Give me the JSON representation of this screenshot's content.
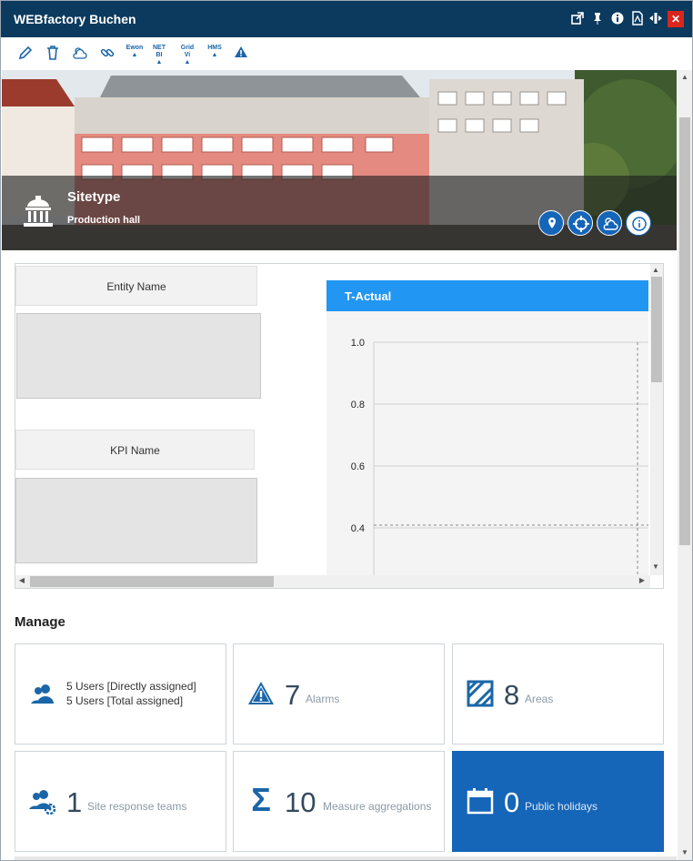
{
  "window": {
    "title": "WEBfactory Buchen"
  },
  "toolbar": {
    "ewon": "Ewon",
    "netbi": "NET BI",
    "gridvi": "Grid Vi",
    "hms": "HMS"
  },
  "hero": {
    "site_type": "Sitetype",
    "site_subtitle": "Production hall"
  },
  "panel": {
    "entity_label": "Entity Name",
    "kpi_label": "KPI Name",
    "chart_title": "T-Actual"
  },
  "chart_data": {
    "type": "line",
    "title": "T-Actual",
    "y_ticks": [
      "1.0",
      "0.8",
      "0.6",
      "0.4"
    ],
    "ylim": [
      0.4,
      1.0
    ],
    "grid": true,
    "series": []
  },
  "manage": {
    "heading": "Manage",
    "users": {
      "line1": "5 Users [Directly assigned]",
      "line2": "5 Users [Total assigned]"
    },
    "alarms": {
      "count": "7",
      "label": "Alarms"
    },
    "areas": {
      "count": "8",
      "label": "Areas"
    },
    "teams": {
      "count": "1",
      "label": "Site response teams"
    },
    "measures": {
      "count": "10",
      "label": "Measure aggregations"
    },
    "holidays": {
      "count": "0",
      "label": "Public holidays"
    }
  },
  "colors": {
    "titlebar": "#0b3a5e",
    "accent": "#1565b8",
    "chart_header": "#2196f3",
    "close": "#d9261c"
  }
}
